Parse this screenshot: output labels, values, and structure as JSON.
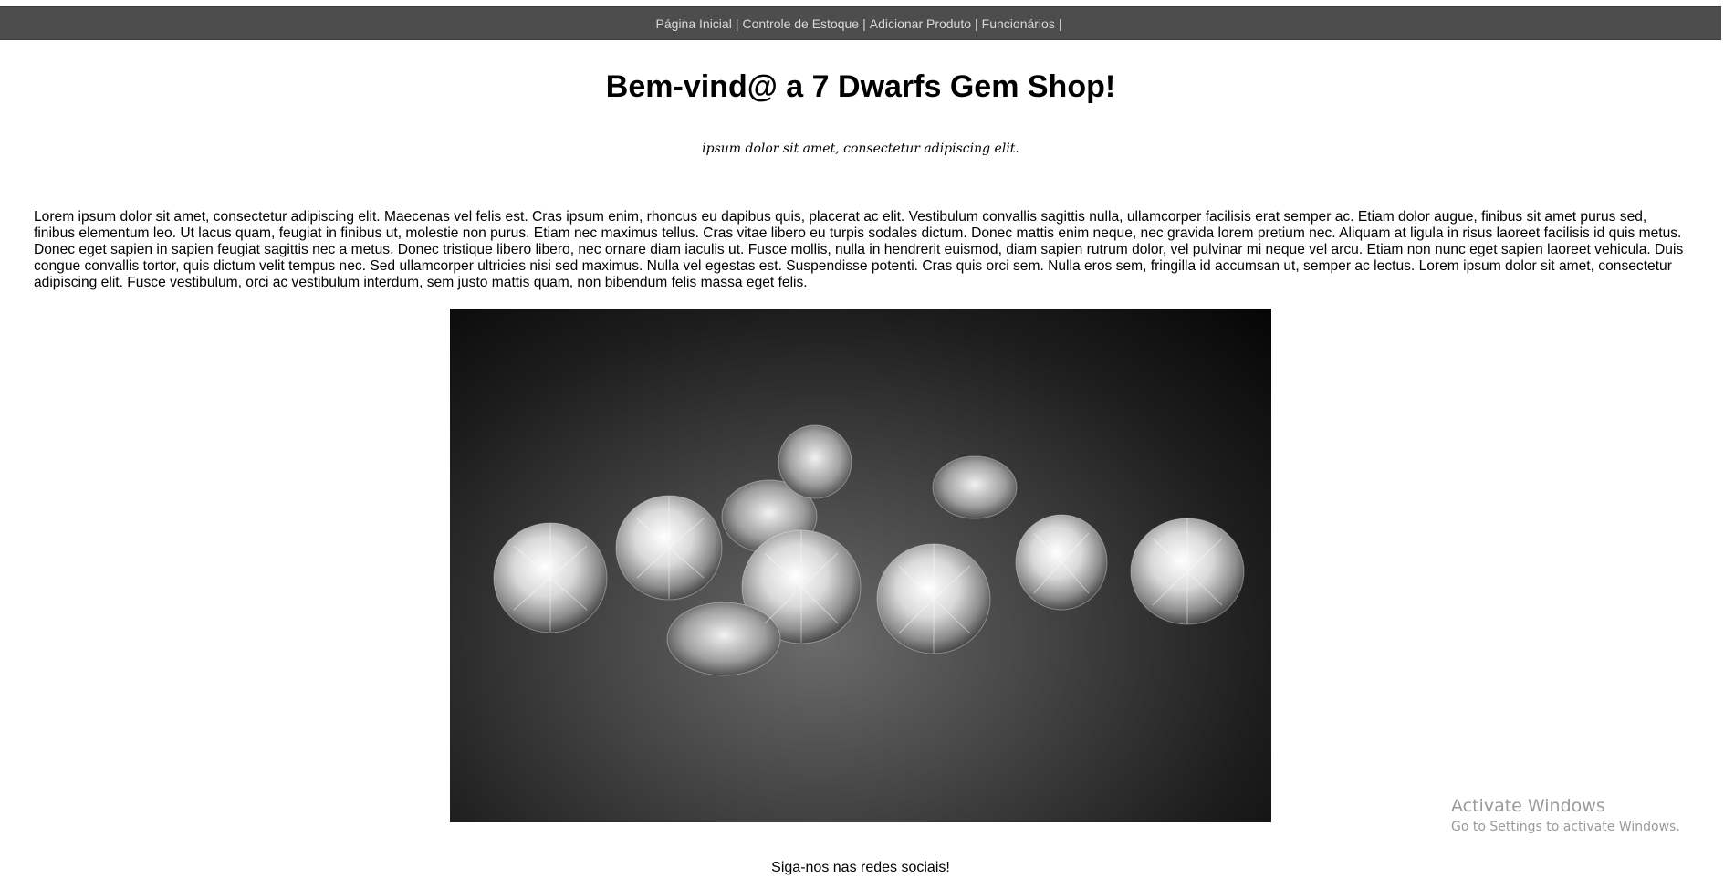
{
  "nav": {
    "items": [
      {
        "label": "Página Inicial"
      },
      {
        "label": "Controle de Estoque"
      },
      {
        "label": "Adicionar Produto"
      },
      {
        "label": "Funcionários"
      }
    ],
    "separator": "|"
  },
  "main": {
    "title": "Bem-vind@ a 7 Dwarfs Gem Shop!",
    "subtitle": "ipsum dolor sit amet, consectetur adipiscing elit.",
    "paragraph": "Lorem ipsum dolor sit amet, consectetur adipiscing elit. Maecenas vel felis est. Cras ipsum enim, rhoncus eu dapibus quis, placerat ac elit. Vestibulum convallis sagittis nulla, ullamcorper facilisis erat semper ac. Etiam dolor augue, finibus sit amet purus sed, finibus elementum leo. Ut lacus quam, feugiat in finibus ut, molestie non purus. Etiam nec maximus tellus. Cras vitae libero eu turpis sodales dictum. Donec mattis enim neque, nec gravida lorem pretium nec. Aliquam at ligula in risus laoreet facilisis id quis metus. Donec eget sapien in sapien feugiat sagittis nec a metus. Donec tristique libero libero, nec ornare diam iaculis ut. Fusce mollis, nulla in hendrerit euismod, diam sapien rutrum dolor, vel pulvinar mi neque vel arcu. Etiam non nunc eget sapien laoreet vehicula. Duis congue convallis tortor, quis dictum velit tempus nec. Sed ullamcorper ultricies nisi sed maximus. Nulla vel egestas est. Suspendisse potenti. Cras quis orci sem. Nulla eros sem, fringilla id accumsan ut, semper ac lectus. Lorem ipsum dolor sit amet, consectetur adipiscing elit. Fusce vestibulum, orci ac vestibulum interdum, sem justo mattis quam, non bibendum felis massa eget felis."
  },
  "footer": {
    "social_text": "Siga-nos nas redes sociais!"
  },
  "watermark": {
    "line1": "Activate Windows",
    "line2": "Go to Settings to activate Windows."
  },
  "colors": {
    "nav_bg": "#4d4d4d",
    "nav_text": "#d8d8d8"
  }
}
